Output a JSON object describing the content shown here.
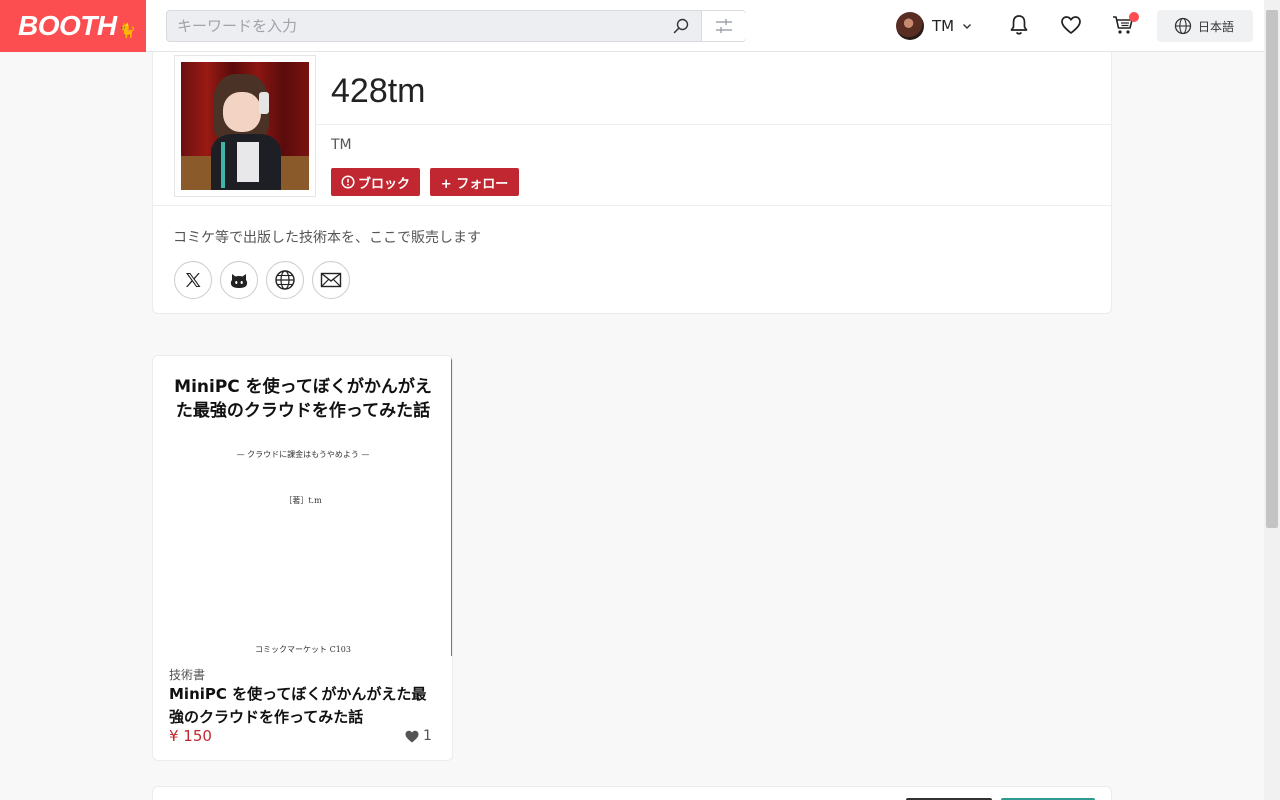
{
  "header": {
    "logo": "BOOTH",
    "search_placeholder": "キーワードを入力",
    "user_name": "TM",
    "language": "日本語"
  },
  "profile": {
    "shop_name": "428tm",
    "display_name": "TM",
    "block_label": "ブロック",
    "follow_label": "+ フォロー",
    "description": "コミケ等で出版した技術本を、ここで販売します",
    "social_icons": [
      "x-icon",
      "github-icon",
      "globe-icon",
      "mail-icon"
    ]
  },
  "product": {
    "cover": {
      "title": "MiniPC を使ってぼくがかんがえた最強のクラウドを作ってみた話",
      "subtitle": "— クラウドに課金はもうやめよう —",
      "author": "［著］t.m",
      "event": "コミックマーケット C103"
    },
    "category": "技術書",
    "title": "MiniPC を使ってぼくがかんがえた最強のクラウドを作ってみた話",
    "price": "¥ 150",
    "likes": "1"
  },
  "colors": {
    "brand": "#fc4d50",
    "button": "#c12730",
    "price": "#c12730"
  }
}
